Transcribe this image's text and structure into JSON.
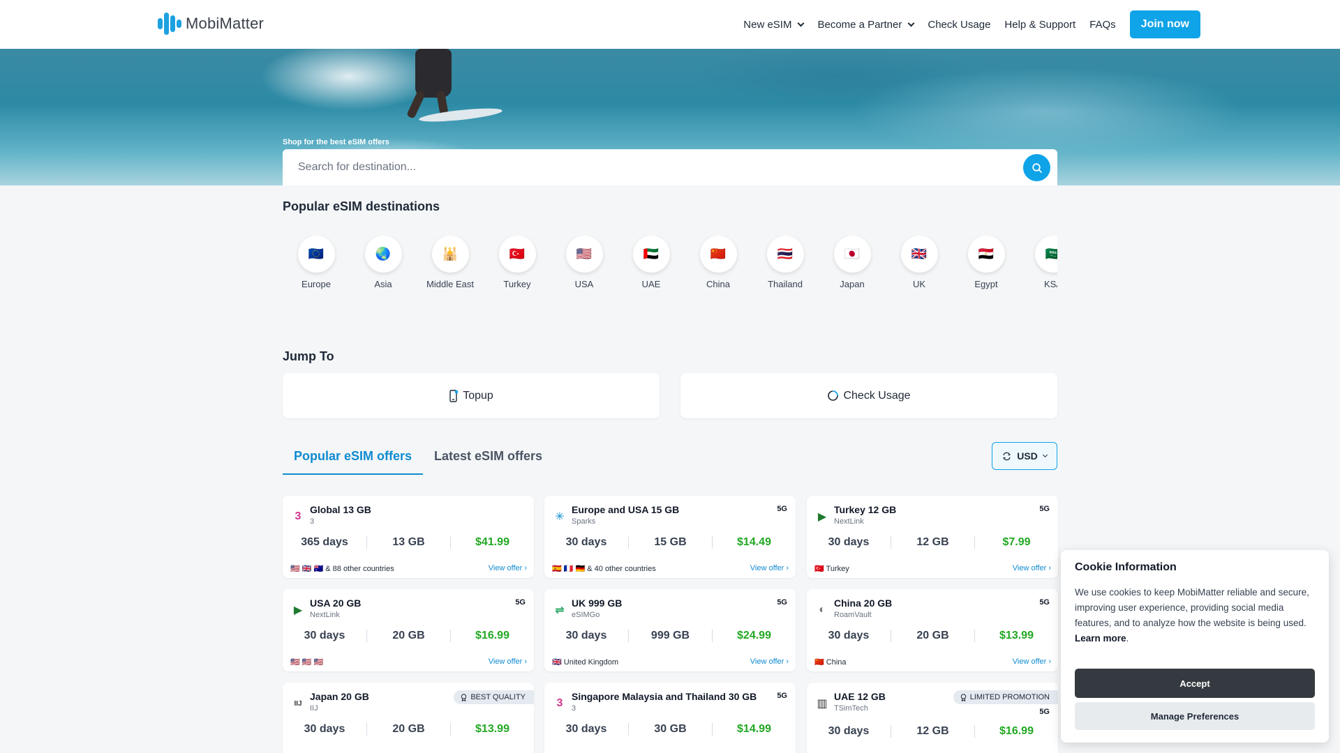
{
  "header": {
    "logo_text": "MobiMatter",
    "nav": [
      "New eSIM",
      "Become a Partner",
      "Check Usage",
      "Help & Support",
      "FAQs"
    ],
    "join_label": "Join now"
  },
  "hero": {
    "label": "Shop for the best eSIM offers",
    "search_placeholder": "Search for destination..."
  },
  "destinations": {
    "title": "Popular eSIM destinations",
    "items": [
      {
        "label": "Europe",
        "icon": "🇪🇺"
      },
      {
        "label": "Asia",
        "icon": "🌏"
      },
      {
        "label": "Middle East",
        "icon": "🕌"
      },
      {
        "label": "Turkey",
        "icon": "🇹🇷"
      },
      {
        "label": "USA",
        "icon": "🇺🇸"
      },
      {
        "label": "UAE",
        "icon": "🇦🇪"
      },
      {
        "label": "China",
        "icon": "🇨🇳"
      },
      {
        "label": "Thailand",
        "icon": "🇹🇭"
      },
      {
        "label": "Japan",
        "icon": "🇯🇵"
      },
      {
        "label": "UK",
        "icon": "🇬🇧"
      },
      {
        "label": "Egypt",
        "icon": "🇪🇬"
      },
      {
        "label": "KSA",
        "icon": "🇸🇦"
      }
    ]
  },
  "jump": {
    "title": "Jump To",
    "topup_label": "Topup",
    "usage_label": "Check Usage"
  },
  "tabs": {
    "popular": "Popular eSIM offers",
    "latest": "Latest eSIM offers",
    "currency": "USD"
  },
  "offers": [
    {
      "title": "Global 13 GB",
      "operator": "3",
      "net": "",
      "badge": "",
      "days": "365 days",
      "data": "13 GB",
      "price": "$41.99",
      "countries": "🇺🇸 🇬🇧 🇦🇺 & 88 other countries",
      "view": "View offer ›",
      "logo_color": "#d0348a",
      "logo": "3"
    },
    {
      "title": "Europe and USA 15 GB",
      "operator": "Sparks",
      "net": "5G",
      "badge": "",
      "days": "30 days",
      "data": "15 GB",
      "price": "$14.49",
      "countries": "🇪🇸 🇫🇷 🇩🇪 & 40 other countries",
      "view": "View offer ›",
      "logo_color": "#0f8bd0",
      "logo": "✳"
    },
    {
      "title": "Turkey 12 GB",
      "operator": "NextLink",
      "net": "5G",
      "badge": "",
      "days": "30 days",
      "data": "12 GB",
      "price": "$7.99",
      "countries": "🇹🇷 Turkey",
      "view": "View offer ›",
      "logo_color": "#1f7a2f",
      "logo": "▶"
    },
    {
      "title": "USA 20 GB",
      "operator": "NextLink",
      "net": "5G",
      "badge": "",
      "days": "30 days",
      "data": "20 GB",
      "price": "$16.99",
      "countries": "🇺🇸 🇺🇸 🇺🇸",
      "view": "View offer ›",
      "logo_color": "#1f7a2f",
      "logo": "▶"
    },
    {
      "title": "UK 999 GB",
      "operator": "eSIMGo",
      "net": "5G",
      "badge": "",
      "days": "30 days",
      "data": "999 GB",
      "price": "$24.99",
      "countries": "🇬🇧 United Kingdom",
      "view": "View offer ›",
      "logo_color": "#1aa35a",
      "logo": "⇌"
    },
    {
      "title": "China 20 GB",
      "operator": "RoamVault",
      "net": "5G",
      "badge": "",
      "days": "30 days",
      "data": "20 GB",
      "price": "$13.99",
      "countries": "🇨🇳 China",
      "view": "View offer ›",
      "logo_color": "#777777",
      "logo": "◐"
    },
    {
      "title": "Japan 20 GB",
      "operator": "IIJ",
      "net": "",
      "badge": "BEST QUALITY",
      "days": "30 days",
      "data": "20 GB",
      "price": "$13.99",
      "countries": "",
      "view": "",
      "logo_color": "#333333",
      "logo": "IIJ"
    },
    {
      "title": "Singapore Malaysia and Thailand 30 GB",
      "operator": "3",
      "net": "5G",
      "badge": "",
      "days": "30 days",
      "data": "30 GB",
      "price": "$14.99",
      "countries": "",
      "view": "",
      "logo_color": "#d0348a",
      "logo": "3"
    },
    {
      "title": "UAE 12 GB",
      "operator": "TSimTech",
      "net": "5G",
      "badge": "LIMITED PROMOTION",
      "days": "30 days",
      "data": "12 GB",
      "price": "$16.99",
      "countries": "",
      "view": "",
      "logo_color": "#333333",
      "logo": "▥"
    }
  ],
  "cookie": {
    "title": "Cookie Information",
    "text": "We use cookies to keep MobiMatter reliable and secure, improving user experience, providing social media features, and to analyze how the website is being used.",
    "learn_more": "Learn more",
    "accept": "Accept",
    "manage": "Manage Preferences"
  }
}
